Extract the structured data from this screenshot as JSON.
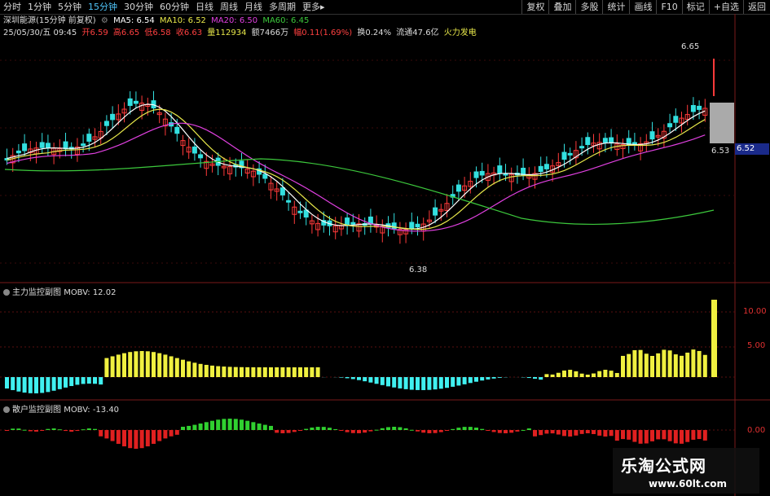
{
  "tabs": [
    "分时",
    "1分钟",
    "5分钟",
    "15分钟",
    "30分钟",
    "60分钟",
    "日线",
    "周线",
    "月线",
    "多周期",
    "更多▸"
  ],
  "active_tab": "15分钟",
  "tools": [
    "复权",
    "叠加",
    "多股",
    "统计",
    "画线",
    "F10",
    "标记",
    "+自选",
    "返回"
  ],
  "stock_title": "深圳能源(15分钟 前复权)",
  "ma": {
    "ma5": "MA5: 6.54",
    "ma10": "MA10: 6.52",
    "ma20": "MA20: 6.50",
    "ma60": "MA60: 6.45"
  },
  "bar_info": {
    "date": "25/05/30/五 09:45",
    "open": "开6.59",
    "high": "高6.65",
    "low": "低6.58",
    "close": "收6.63",
    "vol": "量112934",
    "amount": "额7466万",
    "change": "幅0.11(1.69%)",
    "turnover": "换0.24%",
    "float": "流通47.6亿",
    "concept": "火力发电"
  },
  "price_labels": {
    "high_mark": "6.65",
    "low_mark": "6.38",
    "cur_mark": "6.53",
    "right_tag": "6.52"
  },
  "pane2": {
    "title": "主力监控副图",
    "value": "MOBV: 12.02",
    "ticks": [
      "10.00",
      "5.00"
    ]
  },
  "pane3": {
    "title": "散户监控副图",
    "value": "MOBV: -13.40",
    "ticks": [
      "0.00"
    ]
  },
  "watermark": {
    "line1": "乐淘公式网",
    "line2": "www.60lt.com"
  },
  "colors": {
    "up": "#ff3a3a",
    "down": "#33e0e0",
    "ma5": "#ffffff",
    "ma10": "#e8e84a",
    "ma20": "#e040e0",
    "ma60": "#3cc83c",
    "yellow": "#f0f040",
    "cyan": "#40f0f0",
    "green": "#30d030",
    "red": "#e02020"
  }
}
